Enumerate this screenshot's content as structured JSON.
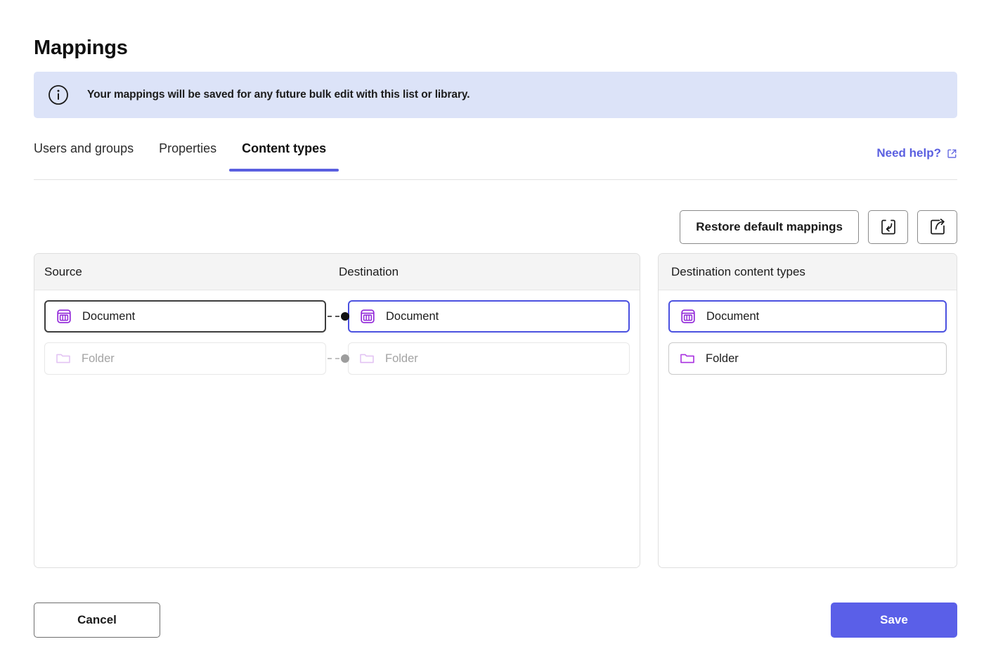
{
  "page": {
    "title": "Mappings"
  },
  "banner": {
    "icon": "info-circle-icon",
    "message": "Your mappings will be saved for any future bulk edit with this list or library."
  },
  "tabs": [
    {
      "label": "Users and groups",
      "active": false
    },
    {
      "label": "Properties",
      "active": false
    },
    {
      "label": "Content types",
      "active": true
    }
  ],
  "need_help": {
    "label": "Need help?",
    "icon": "external-link-icon",
    "color": "#5a5fe0"
  },
  "toolbar": {
    "restore_label": "Restore default mappings",
    "import_icon": "import-icon",
    "export_icon": "export-icon"
  },
  "mapping_panel": {
    "headers": {
      "source": "Source",
      "destination": "Destination"
    },
    "rows": [
      {
        "source": {
          "label": "Document",
          "icon": "document-content-type-icon",
          "state": "active"
        },
        "destination": {
          "label": "Document",
          "icon": "document-content-type-icon",
          "state": "selected"
        },
        "connector": "active"
      },
      {
        "source": {
          "label": "Folder",
          "icon": "folder-content-type-icon",
          "state": "disabled"
        },
        "destination": {
          "label": "Folder",
          "icon": "folder-content-type-icon",
          "state": "disabled"
        },
        "connector": "disabled"
      }
    ]
  },
  "destination_panel": {
    "header": "Destination content types",
    "items": [
      {
        "label": "Document",
        "icon": "document-content-type-icon",
        "state": "selected"
      },
      {
        "label": "Folder",
        "icon": "folder-content-type-icon",
        "state": "active"
      }
    ]
  },
  "footer": {
    "cancel_label": "Cancel",
    "save_label": "Save"
  },
  "colors": {
    "accent": "#5a5fe8",
    "banner_bg": "#dce3f8",
    "content_type_purple": "#9126d9",
    "selected_border": "#4b51e0"
  }
}
